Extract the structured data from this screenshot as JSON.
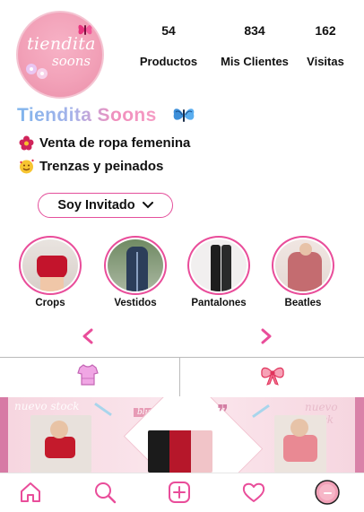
{
  "profile": {
    "avatar_logo_line1": "tiendita",
    "avatar_logo_line2": "soons",
    "name": "Tiendita Soons",
    "bio": [
      {
        "icon": "flower-emoji-icon",
        "text": "Venta de ropa femenina"
      },
      {
        "icon": "smiling-hearts-emoji-icon",
        "text": "Trenzas y peinados"
      }
    ],
    "guest_button_label": "Soy Invitado"
  },
  "stats": [
    {
      "value": "54",
      "label": "Productos"
    },
    {
      "value": "834",
      "label": "Mis Clientes"
    },
    {
      "value": "162",
      "label": "Visitas"
    }
  ],
  "highlights": [
    {
      "label": "Crops"
    },
    {
      "label": "Vestidos"
    },
    {
      "label": "Pantalones"
    },
    {
      "label": "Beatles"
    }
  ],
  "tabs": [
    {
      "icon": "shirt-icon"
    },
    {
      "icon": "bow-icon"
    }
  ],
  "banner": {
    "script_left": "nuevo stock",
    "script_right": "nuevo stock",
    "script_center": "blusas"
  },
  "bottom_nav": [
    {
      "icon": "home-icon"
    },
    {
      "icon": "search-icon"
    },
    {
      "icon": "add-post-icon"
    },
    {
      "icon": "heart-icon"
    },
    {
      "icon": "profile-avatar-icon"
    }
  ],
  "colors": {
    "accent": "#e94d9a",
    "avatar_pink": "#f2a1b8",
    "banner_pink": "#f6d5df"
  }
}
